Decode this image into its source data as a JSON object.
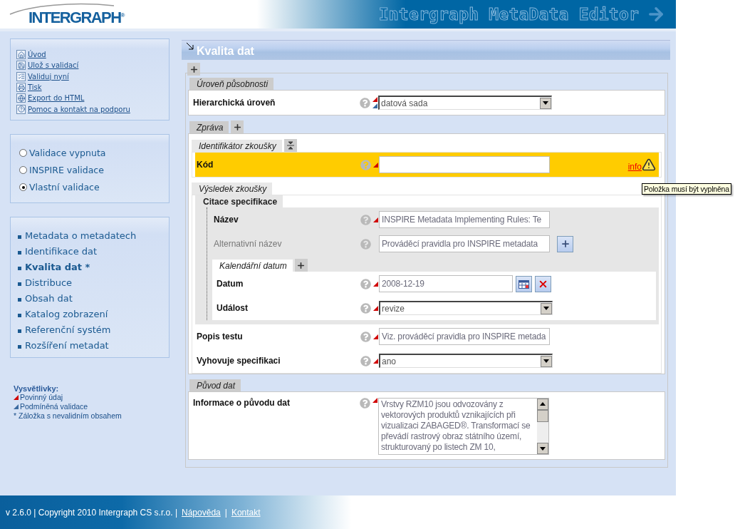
{
  "header": {
    "logo": "INTERGRAPH$^{®}$",
    "title": "Intergraph MetaData Editor"
  },
  "menu": [
    {
      "label": "Úvod"
    },
    {
      "label": "Ulož s validací"
    },
    {
      "label": "Validuj nyní"
    },
    {
      "label": "Tisk"
    },
    {
      "label": "Export do HTML"
    },
    {
      "label": "Pomoc a kontakt na podporu"
    }
  ],
  "validation": [
    {
      "label": "Validace vypnuta",
      "selected": false
    },
    {
      "label": "INSPIRE validace",
      "selected": false
    },
    {
      "label": "Vlastní validace",
      "selected": true
    }
  ],
  "nav": [
    {
      "label": "Metadata o metadatech",
      "selected": false
    },
    {
      "label": "Identifikace dat",
      "selected": false
    },
    {
      "label": "Kvalita dat *",
      "selected": true
    },
    {
      "label": "Distribuce",
      "selected": false
    },
    {
      "label": "Obsah dat",
      "selected": false
    },
    {
      "label": "Katalog zobrazení",
      "selected": false
    },
    {
      "label": "Referenční systém",
      "selected": false
    },
    {
      "label": "Rozšíření metadat",
      "selected": false
    }
  ],
  "legend": {
    "title": "Vysvětlivky:",
    "items": [
      {
        "kind": "required",
        "text": "Povinný údaj"
      },
      {
        "kind": "conditional",
        "text": "Podmíněná validace"
      },
      {
        "kind": "note",
        "text": "* Záložka s nevalidním obsahem"
      }
    ]
  },
  "page": {
    "title": "Kvalita dat",
    "can_add": true,
    "sections": [
      {
        "kind": "section",
        "title": "Úroveň působnosti",
        "children": [
          {
            "kind": "select",
            "label": "Hierarchická úroveň",
            "value": "datová sada",
            "required": true,
            "conditional": true
          }
        ]
      },
      {
        "kind": "section",
        "title": "Zpráva",
        "can_add": true,
        "children": [
          {
            "kind": "subsection",
            "title": "Identifikátor zkoušky",
            "collapsible": true,
            "children": [
              {
                "kind": "text",
                "label": "Kód",
                "required": true,
                "invalid": true,
                "info": "info",
                "tooltip": "Položka musí být vyplněna"
              }
            ]
          },
          {
            "kind": "subsection",
            "title": "Výsledek zkoušky",
            "children": [
              {
                "kind": "citation",
                "title": "Citace specifikace",
                "children": [
                  {
                    "kind": "text",
                    "label": "Název",
                    "value": "INSPIRE Metadata Implementing Rules: Te",
                    "required": true
                  },
                  {
                    "kind": "text",
                    "label": "Alternativní název",
                    "value": "Prováděcí pravidla pro INSPIRE metadata",
                    "required": false,
                    "can_add": true
                  },
                  {
                    "kind": "calendar",
                    "title": "Kalendářní datum",
                    "can_add": true,
                    "children": [
                      {
                        "kind": "date",
                        "label": "Datum",
                        "value": "2008-12-19",
                        "required": true
                      },
                      {
                        "kind": "select",
                        "label": "Událost",
                        "value": "revize",
                        "required": true
                      }
                    ]
                  }
                ]
              },
              {
                "kind": "text",
                "label": "Popis testu",
                "value": "Viz. prováděcí pravidla pro INSPIRE metada",
                "required": true
              },
              {
                "kind": "select",
                "label": "Vyhovuje specifikaci",
                "value": "ano",
                "required": true
              }
            ]
          }
        ]
      },
      {
        "kind": "section",
        "title": "Původ dat",
        "children": [
          {
            "kind": "textarea",
            "label": "Informace o původu dat",
            "value": "Vrstvy RZM10 jsou odvozovány z vektorových produktů vznikajících při vizualizaci ZABAGED®. Transformací se převádí rastrový obraz státního území, strukturovaný po listech ZM 10,",
            "required": true
          }
        ]
      }
    ]
  },
  "footer": {
    "copyright": "v 2.6.0 | Copyright 2010 Intergraph CS s.r.o. |",
    "links": [
      "Nápověda",
      "Kontakt"
    ],
    "separator": "|"
  }
}
